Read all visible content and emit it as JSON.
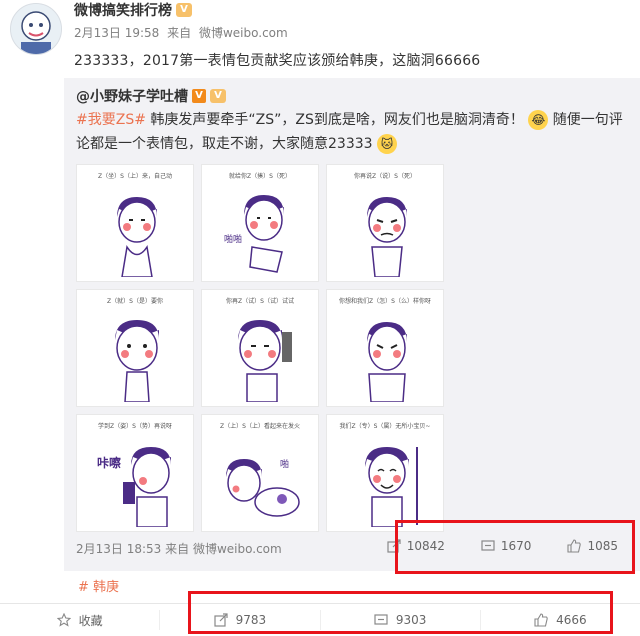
{
  "post": {
    "author": "微博搞笑排行榜",
    "date": "2月13日 19:58",
    "via_prefix": "来自",
    "source": "微博weibo.com",
    "text": "233333，2017第一表情包贡献奖应该颁给韩庚，这脑洞66666"
  },
  "repost": {
    "author": "@小野妹子学吐槽",
    "tag": "#我要ZS#",
    "text_part1": "韩庚发声要牵手“ZS”，ZS到底是啥，网友们也是脑洞清奇！",
    "text_part2": "随便一句评论都是一个表情包，取走不谢，大家随意23333",
    "captions": [
      "Z（坐）S（上）来，自己动",
      "就给你Z（揍）S（死）",
      "你再说Z（说）S（死）",
      "Z（就）S（是）要你",
      "你再Z（试）S（试）试试",
      "你想和我们Z（怎）S（么）样你呀",
      "学到Z（姿）S（势）再说呀",
      "Z（上）S（上）看起来在发火",
      "我们Z（专）S（属）无所小宝贝~"
    ],
    "footer_date": "2月13日 18:53",
    "footer_via": "来自",
    "footer_source": "微博weibo.com",
    "stats": {
      "reposts": "10842",
      "comments": "1670",
      "likes": "1085"
    }
  },
  "hashtag": "韩庚",
  "bottom": {
    "collect": "收藏",
    "reposts": "9783",
    "comments": "9303",
    "likes": "4666"
  },
  "colors": {
    "accent": "#eb7350",
    "highlight": "#e8141b"
  }
}
